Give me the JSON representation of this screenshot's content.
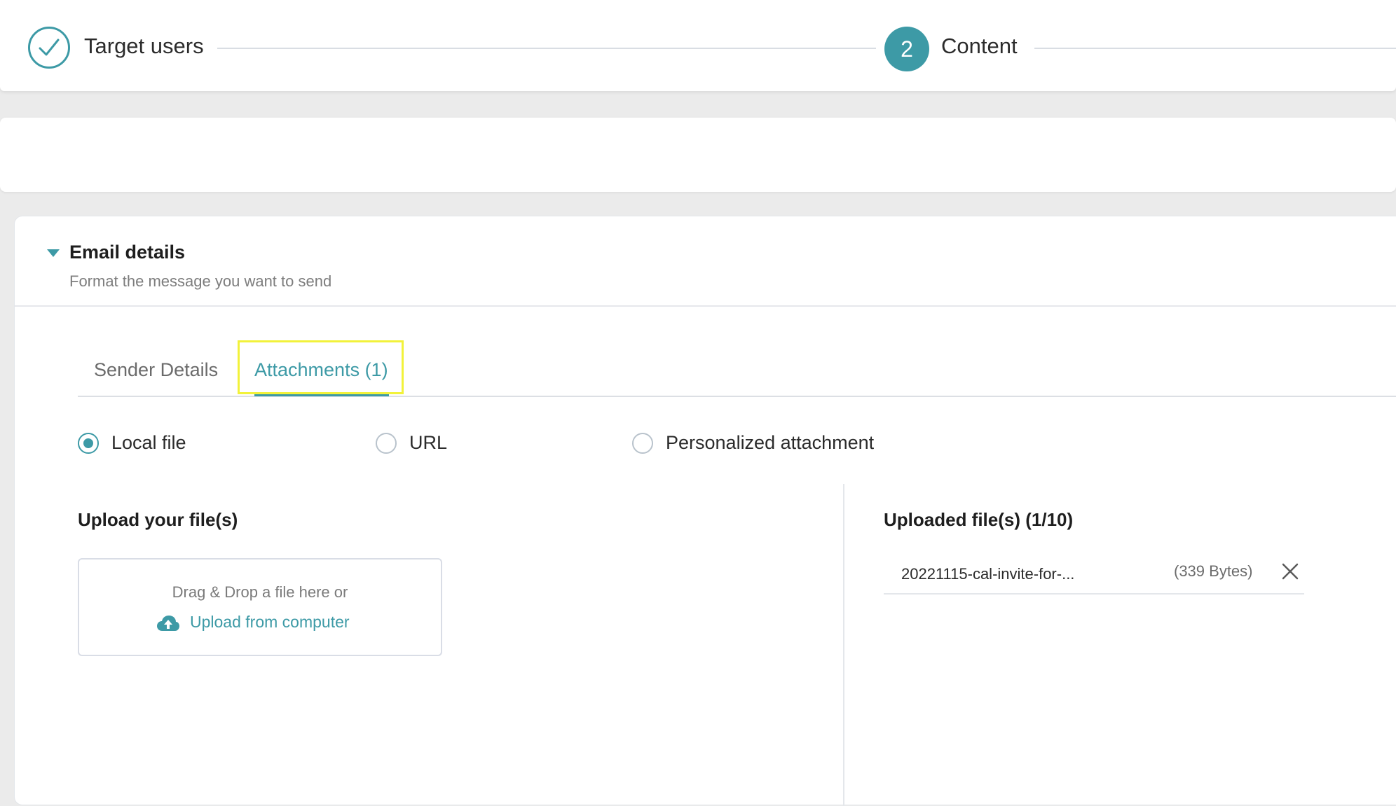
{
  "stepper": {
    "steps": [
      {
        "label": "Target users",
        "status": "completed"
      },
      {
        "label": "Content",
        "number": "2",
        "status": "active"
      }
    ]
  },
  "email_details": {
    "title": "Email details",
    "subtitle": "Format the message you want to send",
    "tabs": [
      {
        "label": "Sender Details",
        "active": false
      },
      {
        "label": "Attachments (1)",
        "active": true
      }
    ],
    "attachment_source": {
      "options": [
        {
          "label": "Local file",
          "checked": true
        },
        {
          "label": "URL",
          "checked": false
        },
        {
          "label": "Personalized attachment",
          "checked": false
        }
      ]
    },
    "upload": {
      "title": "Upload your file(s)",
      "drop_text": "Drag & Drop a file here or",
      "upload_link": "Upload from computer",
      "icon": "cloud-upload-icon"
    },
    "uploaded": {
      "title": "Uploaded file(s) (1/10)",
      "files": [
        {
          "name": "20221115-cal-invite-for-...",
          "size": "(339 Bytes)"
        }
      ]
    }
  },
  "colors": {
    "accent": "#3d9aa6",
    "highlight": "#f2f23a",
    "background": "#ebebeb"
  }
}
